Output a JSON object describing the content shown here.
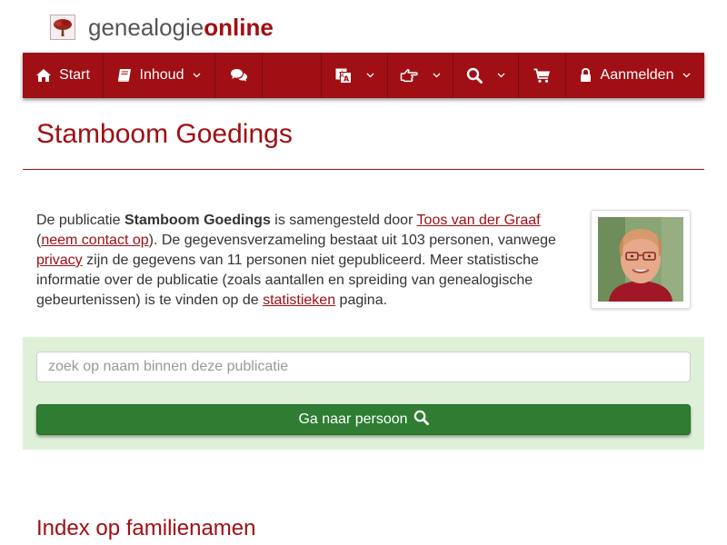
{
  "logo": {
    "part1": "genealogie",
    "part2": "online"
  },
  "nav": {
    "start_label": "Start",
    "inhoud_label": "Inhoud",
    "login_label": "Aanmelden",
    "icons": [
      "home-icon",
      "book-icon",
      "comments-icon",
      "language-icon",
      "thumbs-icon",
      "search-icon",
      "cart-icon",
      "lock-icon",
      "chevron-down-icon"
    ]
  },
  "page": {
    "title": "Stamboom Goedings"
  },
  "intro": {
    "t1": "De publicatie ",
    "pub_name": "Stamboom Goedings",
    "t2": " is samengesteld door ",
    "author_link": "Toos van der Graaf",
    "t3": " (",
    "contact_link": "neem contact op",
    "t4": "). De gegevensverzameling bestaat uit 103 personen, vanwege ",
    "privacy_link": "privacy",
    "t5": " zijn de gegevens van 11 personen niet gepubliceerd. Meer statistische informatie over de publicatie (zoals aantallen en spreiding van genealogische gebeurtenissen) is te vinden op de ",
    "stats_link": "statistieken",
    "t6": " pagina."
  },
  "search": {
    "placeholder": "zoek op naam binnen deze publicatie",
    "value": "",
    "button_label": "Ga naar persoon"
  },
  "sections": {
    "family_index": "Index op familienamen"
  },
  "colors": {
    "brand": "#a00f14",
    "panel": "#dff0d8",
    "button": "#2e7d32"
  }
}
